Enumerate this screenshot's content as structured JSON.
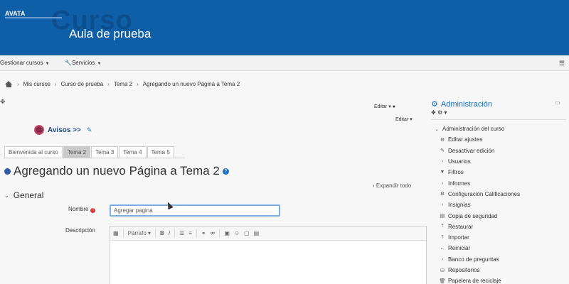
{
  "header": {
    "logo": "AVATA",
    "background_word": "Curso",
    "site_title": "Aula de prueba"
  },
  "navbar": {
    "items": [
      {
        "label": "Gestionar cursos"
      },
      {
        "label": "Servicios"
      }
    ]
  },
  "breadcrumb": {
    "items": [
      "Mis cursos",
      "Curso de prueba",
      "Tema 2",
      "Agregando un nuevo Página a Tema 2"
    ]
  },
  "editar_labels": [
    "Editar",
    "Editar"
  ],
  "avisos": {
    "label": "Avisos >>"
  },
  "tabs": [
    {
      "label": "Bienvenida al curso",
      "active": false
    },
    {
      "label": "Tema 2",
      "active": true
    },
    {
      "label": "Tema 3",
      "active": false
    },
    {
      "label": "Tema 4",
      "active": false
    },
    {
      "label": "Tema 5",
      "active": false
    }
  ],
  "page": {
    "heading": "Agregando un nuevo Página a Tema 2",
    "expand_all": "Expandir todo",
    "section": "General"
  },
  "form": {
    "nombre_label": "Nombre",
    "nombre_value": "Agregar pagina",
    "descripcion_label": "Descripción",
    "editor_toolbar": {
      "format_select": "Párrafo"
    }
  },
  "admin": {
    "title": "Administración",
    "items": [
      {
        "label": "Administración del curso",
        "icon": "chevron-down",
        "type": "head"
      },
      {
        "label": "Editar ajustes",
        "icon": "gear",
        "type": "sub"
      },
      {
        "label": "Desactivar edición",
        "icon": "pencil",
        "type": "sub"
      },
      {
        "label": "Usuarios",
        "icon": "chevron-right",
        "type": "sub"
      },
      {
        "label": "Filtros",
        "icon": "filter",
        "type": "sub"
      },
      {
        "label": "Informes",
        "icon": "chevron-right",
        "type": "sub"
      },
      {
        "label": "Configuración Calificaciones",
        "icon": "gear",
        "type": "sub"
      },
      {
        "label": "Insignias",
        "icon": "chevron-right",
        "type": "sub"
      },
      {
        "label": "Copia de seguridad",
        "icon": "document",
        "type": "sub"
      },
      {
        "label": "Restaurar",
        "icon": "upload",
        "type": "sub"
      },
      {
        "label": "Importar",
        "icon": "upload",
        "type": "sub"
      },
      {
        "label": "Reiniciar",
        "icon": "arrow-left",
        "type": "sub"
      },
      {
        "label": "Banco de preguntas",
        "icon": "chevron-right",
        "type": "sub"
      },
      {
        "label": "Repositorios",
        "icon": "database",
        "type": "sub"
      },
      {
        "label": "Papelera de reciclaje",
        "icon": "trash",
        "type": "sub"
      }
    ]
  }
}
